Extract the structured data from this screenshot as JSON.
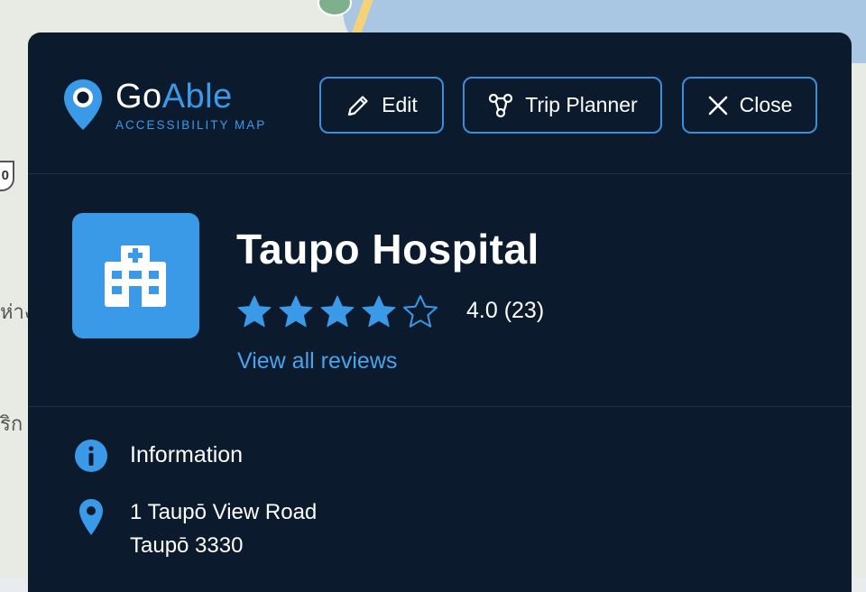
{
  "app": {
    "brand_prefix": "Go",
    "brand_suffix": "Able",
    "tagline": "ACCESSIBILITY MAP",
    "accent_color": "#3b9ae8",
    "panel_color": "#0c1a2e"
  },
  "map": {
    "shield_label": "0",
    "label_1": "ห่าง",
    "label_2": "ริก"
  },
  "toolbar": {
    "edit_label": "Edit",
    "trip_label": "Trip Planner",
    "close_label": "Close",
    "edit_icon": "pencil-icon",
    "trip_icon": "route-icon",
    "close_icon": "close-icon"
  },
  "place": {
    "icon": "hospital-icon",
    "name": "Taupo Hospital",
    "rating_value": 4.0,
    "stars_total": 5,
    "rating_text": "4.0 (23)",
    "reviews_link": "View all reviews"
  },
  "info": {
    "heading": "Information",
    "heading_icon": "info-icon",
    "address_icon": "location-pin-icon",
    "address_line1": "1 Taupō View Road",
    "address_line2": "Taupō 3330"
  }
}
